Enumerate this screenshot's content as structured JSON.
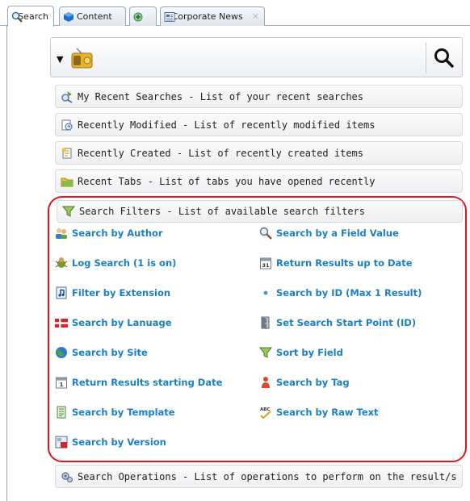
{
  "tabs": [
    {
      "label": "Search",
      "icon": "search-icon",
      "active": true
    },
    {
      "label": "Content",
      "icon": "content-icon",
      "active": false
    },
    {
      "label": "",
      "icon": "add-tab-icon",
      "active": false
    },
    {
      "label": "Corporate News",
      "icon": "news-icon",
      "active": false,
      "close": "✕"
    }
  ],
  "searchbar": {
    "dropdown_glyph": "▼",
    "database_icon": "radio-icon",
    "search_icon": "magnifier-icon"
  },
  "sections": {
    "recent_searches": "My Recent Searches - List of your recent searches",
    "recently_modified": "Recently Modified - List of recently modified items",
    "recently_created": "Recently Created - List of recently created items",
    "recent_tabs": "Recent Tabs - List of tabs you have opened recently",
    "search_filters": "Search Filters - List of available search filters",
    "search_operations": "Search Operations - List of operations to perform on the result/s"
  },
  "filters": {
    "left": [
      {
        "label": "Search by Author",
        "icon": "people-icon"
      },
      {
        "label": "Log Search (1 is on)",
        "icon": "bug-icon"
      },
      {
        "label": "Filter by Extension",
        "icon": "music-file-icon"
      },
      {
        "label": "Search by Lanuage",
        "icon": "flag-icon"
      },
      {
        "label": "Search by Site",
        "icon": "globe-icon"
      },
      {
        "label": "Return Results starting Date",
        "icon": "calendar-icon"
      },
      {
        "label": "Search by Template",
        "icon": "document-icon"
      },
      {
        "label": "Search by Version",
        "icon": "version-icon"
      }
    ],
    "right": [
      {
        "label": "Search by a Field Value",
        "icon": "zoom-icon"
      },
      {
        "label": "Return Results up to Date",
        "icon": "calendar-31-icon"
      },
      {
        "label": "Search by ID (Max 1 Result)",
        "icon": "dot-icon"
      },
      {
        "label": "Set Search Start Point (ID)",
        "icon": "door-icon"
      },
      {
        "label": "Sort by Field",
        "icon": "funnel-icon"
      },
      {
        "label": "Search by Tag",
        "icon": "tag-person-icon"
      },
      {
        "label": "Search by Raw Text",
        "icon": "spellcheck-icon"
      }
    ]
  },
  "colors": {
    "link": "#1a7fc6",
    "highlight_border": "#e8121a"
  }
}
